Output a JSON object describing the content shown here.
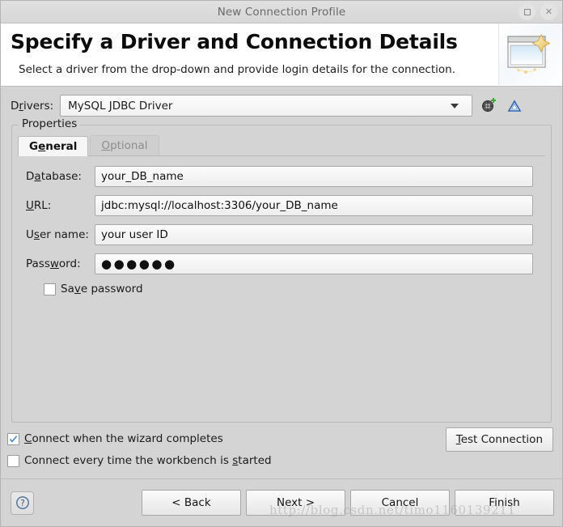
{
  "window": {
    "title": "New Connection Profile",
    "maximize_icon": "maximize-icon",
    "close_icon": "close-icon"
  },
  "header": {
    "title": "Specify a Driver and Connection Details",
    "subtitle": "Select a driver from the drop-down and provide login details for the connection.",
    "banner_icon": "new-connection-wizard-banner-icon"
  },
  "drivers": {
    "label_pre": "D",
    "label_mn": "r",
    "label_post": "ivers:",
    "label_full": "Drivers:",
    "selected": "MySQL JDBC Driver",
    "new_driver_icon": "new-driver-definition-icon",
    "edit_driver_icon": "edit-driver-definition-icon"
  },
  "properties": {
    "legend": "Properties",
    "tabs": [
      {
        "pre": "G",
        "mn": "e",
        "post": "neral",
        "full": "General",
        "active": true
      },
      {
        "pre": "",
        "mn": "O",
        "post": "ptional",
        "full": "Optional",
        "active": false
      }
    ],
    "fields": [
      {
        "pre": "D",
        "mn": "a",
        "post": "tabase:",
        "full": "Database:",
        "value": "your_DB_name",
        "type": "text"
      },
      {
        "pre": "",
        "mn": "U",
        "post": "RL:",
        "full": "URL:",
        "value": "jdbc:mysql://localhost:3306/your_DB_name",
        "type": "text"
      },
      {
        "pre": "U",
        "mn": "s",
        "post": "er name:",
        "full": "User name:",
        "value": "your user ID",
        "type": "text"
      },
      {
        "pre": "Pass",
        "mn": "w",
        "post": "ord:",
        "full": "Password:",
        "value": "●●●●●●",
        "type": "password"
      }
    ],
    "save_password": {
      "pre": "Sa",
      "mn": "v",
      "post": "e password",
      "full": "Save password",
      "checked": false
    }
  },
  "options": [
    {
      "pre": "",
      "mn": "C",
      "post": "onnect when the wizard completes",
      "full": "Connect when the wizard completes",
      "checked": true
    },
    {
      "pre": "Connect every time the workbench is ",
      "mn": "s",
      "post": "tarted",
      "full": "Connect every time the workbench is started",
      "checked": false
    }
  ],
  "test_connection": {
    "pre": "",
    "mn": "T",
    "post": "est Connection",
    "full": "Test Connection"
  },
  "footer": {
    "help_label": "?",
    "buttons": [
      {
        "label": "< Back",
        "name": "back-button"
      },
      {
        "label": "Next >",
        "name": "next-button"
      },
      {
        "label": "Cancel",
        "name": "cancel-button"
      },
      {
        "label": "Finish",
        "name": "finish-button"
      }
    ]
  },
  "watermark": "http://blog.csdn.net/timo1160139211",
  "colors": {
    "dialog_bg": "#d4d4d4",
    "header_bg": "#ffffff",
    "field_bg": "#fcfcfc",
    "check_accent": "#3b7fd4",
    "border": "#b9b9b9"
  }
}
